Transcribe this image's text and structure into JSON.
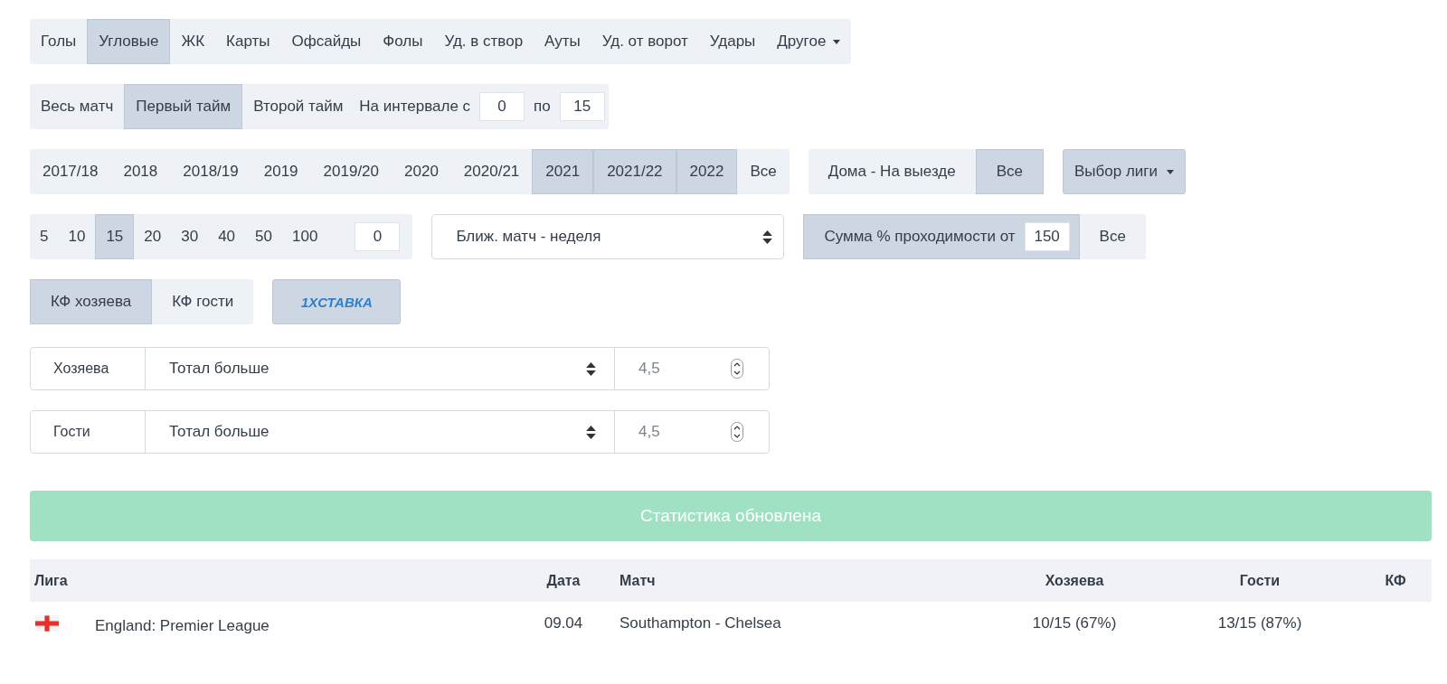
{
  "stat_tabs": [
    {
      "label": "Голы",
      "selected": false,
      "kind": "tab"
    },
    {
      "label": "Угловые",
      "selected": true,
      "kind": "tab"
    },
    {
      "label": "ЖК",
      "selected": false,
      "kind": "tab"
    },
    {
      "label": "Карты",
      "selected": false,
      "kind": "tab"
    },
    {
      "label": "Офсайды",
      "selected": false,
      "kind": "tab"
    },
    {
      "label": "Фолы",
      "selected": false,
      "kind": "tab"
    },
    {
      "label": "Уд. в створ",
      "selected": false,
      "kind": "tab"
    },
    {
      "label": "Ауты",
      "selected": false,
      "kind": "tab"
    },
    {
      "label": "Уд. от ворот",
      "selected": false,
      "kind": "tab"
    },
    {
      "label": "Удары",
      "selected": false,
      "kind": "tab"
    },
    {
      "label": "Другое",
      "selected": false,
      "kind": "dropdown"
    }
  ],
  "period": {
    "options": [
      {
        "label": "Весь матч",
        "selected": false
      },
      {
        "label": "Первый тайм",
        "selected": true
      },
      {
        "label": "Второй тайм",
        "selected": false
      }
    ],
    "interval_label": "На интервале с",
    "from": "0",
    "to_label": "по",
    "to": "15"
  },
  "seasons": [
    {
      "label": "2017/18",
      "selected": false
    },
    {
      "label": "2018",
      "selected": false
    },
    {
      "label": "2018/19",
      "selected": false
    },
    {
      "label": "2019",
      "selected": false
    },
    {
      "label": "2019/20",
      "selected": false
    },
    {
      "label": "2020",
      "selected": false
    },
    {
      "label": "2020/21",
      "selected": false
    },
    {
      "label": "2021",
      "selected": true
    },
    {
      "label": "2021/22",
      "selected": true
    },
    {
      "label": "2022",
      "selected": true
    },
    {
      "label": "Все",
      "selected": false
    }
  ],
  "venue": [
    {
      "label": "Дома - На выезде",
      "selected": false
    },
    {
      "label": "Все",
      "selected": true
    }
  ],
  "league_dropdown": {
    "label": "Выбор лиги"
  },
  "counts": {
    "options": [
      {
        "label": "5",
        "selected": false
      },
      {
        "label": "10",
        "selected": false
      },
      {
        "label": "15",
        "selected": true
      },
      {
        "label": "20",
        "selected": false
      },
      {
        "label": "30",
        "selected": false
      },
      {
        "label": "40",
        "selected": false
      },
      {
        "label": "50",
        "selected": false
      },
      {
        "label": "100",
        "selected": false
      }
    ],
    "custom": "0"
  },
  "next_match_select": {
    "value": "Ближ. матч - неделя"
  },
  "sum_filter": {
    "label": "Сумма % проходимости от",
    "value": "150",
    "all_label": "Все",
    "all_selected": false
  },
  "odds_side": [
    {
      "label": "КФ хозяева",
      "selected": true
    },
    {
      "label": "КФ гости",
      "selected": false
    }
  ],
  "bookmaker_button": {
    "label": "1XСТАВКА"
  },
  "bet_rows": [
    {
      "team": "Хозяева",
      "market": "Тотал больше",
      "placeholder": "4,5"
    },
    {
      "team": "Гости",
      "market": "Тотал больше",
      "placeholder": "4,5"
    }
  ],
  "status_banner": "Статистика обновлена",
  "table": {
    "columns": [
      "Лига",
      "Дата",
      "Матч",
      "Хозяева",
      "Гости",
      "КФ"
    ],
    "rows": [
      {
        "league": "England: Premier League",
        "date": "09.04",
        "match": "Southampton - Chelsea",
        "home": "10/15 (67%)",
        "away": "13/15 (87%)"
      }
    ]
  }
}
